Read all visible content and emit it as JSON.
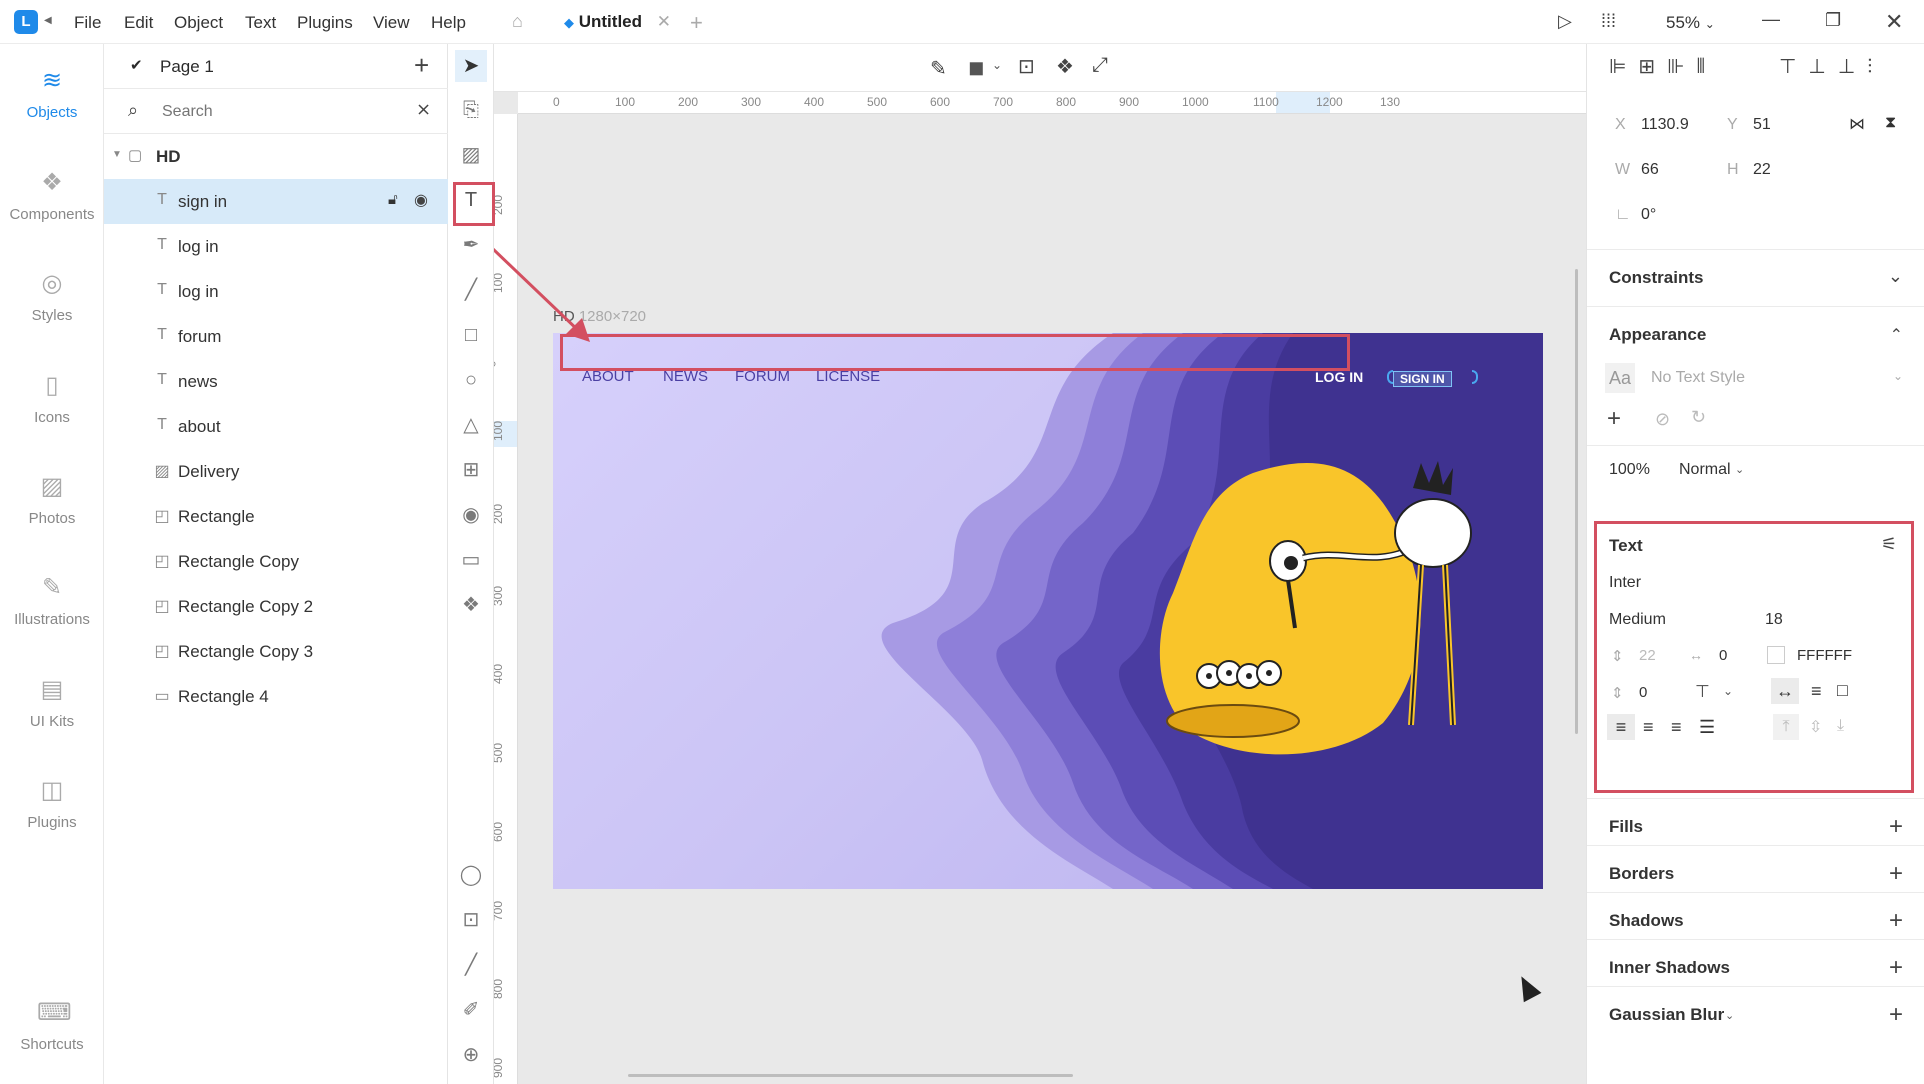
{
  "titlebar": {
    "logo": "L",
    "menus": [
      "File",
      "Edit",
      "Object",
      "Text",
      "Plugins",
      "View",
      "Help"
    ],
    "tab_title": "Untitled",
    "zoom": "55%"
  },
  "nav": {
    "items": [
      {
        "label": "Objects",
        "icon": "layers-icon"
      },
      {
        "label": "Components",
        "icon": "components-icon"
      },
      {
        "label": "Styles",
        "icon": "styles-icon"
      },
      {
        "label": "Icons",
        "icon": "icons-icon"
      },
      {
        "label": "Photos",
        "icon": "photos-icon"
      },
      {
        "label": "Illustrations",
        "icon": "illustrations-icon"
      },
      {
        "label": "UI Kits",
        "icon": "uikits-icon"
      },
      {
        "label": "Plugins",
        "icon": "plugins-icon"
      }
    ],
    "shortcuts": "Shortcuts"
  },
  "layers": {
    "page": "Page 1",
    "search_placeholder": "Search",
    "group": "HD",
    "items": [
      {
        "name": "sign in",
        "type": "T",
        "selected": true
      },
      {
        "name": "log in",
        "type": "T"
      },
      {
        "name": "log in",
        "type": "T"
      },
      {
        "name": "forum",
        "type": "T"
      },
      {
        "name": "news",
        "type": "T"
      },
      {
        "name": "about",
        "type": "T"
      },
      {
        "name": "Delivery",
        "type": "img"
      },
      {
        "name": "Rectangle",
        "type": "rect"
      },
      {
        "name": "Rectangle Copy",
        "type": "rect"
      },
      {
        "name": "Rectangle Copy 2",
        "type": "rect"
      },
      {
        "name": "Rectangle Copy 3",
        "type": "rect"
      },
      {
        "name": "Rectangle 4",
        "type": "rect"
      }
    ]
  },
  "canvas": {
    "artboard_name": "HD",
    "artboard_size": "1280×720",
    "ruler_h": [
      "0",
      "100",
      "200",
      "300",
      "400",
      "500",
      "600",
      "700",
      "800",
      "900",
      "1000",
      "1100",
      "1200",
      "130"
    ],
    "ruler_v": [
      "200",
      "100",
      "0",
      "100",
      "200",
      "300",
      "400",
      "500",
      "600",
      "700",
      "800",
      "900"
    ],
    "site_nav": {
      "links": [
        "ABOUT",
        "NEWS",
        "FORUM",
        "LICENSE"
      ],
      "login": "LOG IN",
      "signin": "SIGN IN"
    }
  },
  "inspector": {
    "x_label": "X",
    "x": "1130.9",
    "y_label": "Y",
    "y": "51",
    "w_label": "W",
    "w": "66",
    "h_label": "H",
    "h": "22",
    "rotation": "0°",
    "constraints": "Constraints",
    "appearance": "Appearance",
    "text_style_prefix": "Aa",
    "text_style": "No Text Style",
    "opacity": "100%",
    "blend": "Normal",
    "text_section": "Text",
    "font": "Inter",
    "weight": "Medium",
    "size": "18",
    "line_height": "22",
    "letter_spacing": "0",
    "color": "FFFFFF",
    "paragraph": "0",
    "fills": "Fills",
    "borders": "Borders",
    "shadows": "Shadows",
    "inner_shadows": "Inner Shadows",
    "blur": "Gaussian Blur"
  },
  "colors": {
    "accent": "#1f8ae9",
    "highlight": "#d34f60",
    "artboard_dark": "#3f3290",
    "blob": "#f9c52a"
  }
}
